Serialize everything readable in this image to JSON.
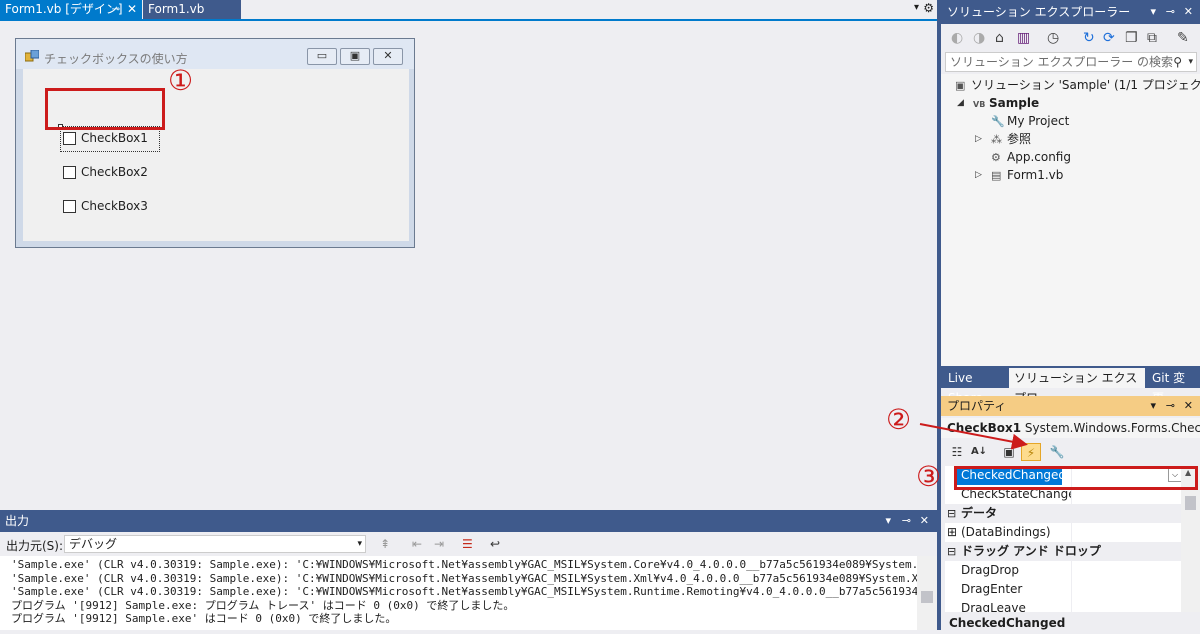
{
  "designer": {
    "tabs": [
      {
        "label": "Form1.vb [デザイン]",
        "pin": "⊸",
        "close": "✕"
      },
      {
        "label": "Form1.vb"
      }
    ],
    "dropdown_glyph": "▾",
    "gear_glyph": "⚙",
    "form": {
      "title": "チェックボックスの使い方",
      "minimize": "▭",
      "maximize": "▣",
      "close": "✕",
      "checkboxes": [
        "CheckBox1",
        "CheckBox2",
        "CheckBox3"
      ]
    },
    "marker1": "①"
  },
  "output": {
    "title": "出力",
    "header_controls": [
      "▾",
      "⊸",
      "✕"
    ],
    "source_label": "出力元(S):",
    "source_value": "デバッグ",
    "dd_glyph": "▾",
    "lines": [
      "'Sample.exe' (CLR v4.0.30319: Sample.exe): 'C:¥WINDOWS¥Microsoft.Net¥assembly¥GAC_MSIL¥System.Core¥v4.0_4.0.0.0__b77a5c561934e089¥System.Core.dll' が読",
      "'Sample.exe' (CLR v4.0.30319: Sample.exe): 'C:¥WINDOWS¥Microsoft.Net¥assembly¥GAC_MSIL¥System.Xml¥v4.0_4.0.0.0__b77a5c561934e089¥System.Xml.dll' が読み",
      "'Sample.exe' (CLR v4.0.30319: Sample.exe): 'C:¥WINDOWS¥Microsoft.Net¥assembly¥GAC_MSIL¥System.Runtime.Remoting¥v4.0_4.0.0.0__b77a5c561934e089¥System.Ru",
      "プログラム '[9912] Sample.exe: プログラム トレース' はコード 0 (0x0) で終了しました。",
      "プログラム '[9912] Sample.exe' はコード 0 (0x0) で終了しました。"
    ]
  },
  "solution_explorer": {
    "title": "ソリューション エクスプローラー",
    "header_controls": [
      "▾",
      "⊸",
      "✕"
    ],
    "search_placeholder": "ソリューション エクスプローラー の検索 (Ctrl+;)",
    "search_icon": "⚲",
    "search_dd": "▾",
    "tree": [
      {
        "label": "ソリューション 'Sample' (1/1 プロジェクト)",
        "icon": "▣",
        "indent": 0,
        "expander": ""
      },
      {
        "label": "Sample",
        "icon": "VB",
        "indent": 1,
        "expander": "◢",
        "bold": true
      },
      {
        "label": "My Project",
        "icon": "🔧",
        "indent": 2,
        "expander": ""
      },
      {
        "label": "参照",
        "icon": "⁂",
        "indent": 2,
        "expander": "▷"
      },
      {
        "label": "App.config",
        "icon": "⚙",
        "indent": 2,
        "expander": ""
      },
      {
        "label": "Form1.vb",
        "icon": "▤",
        "indent": 2,
        "expander": "▷"
      }
    ],
    "tabs": [
      "Live Share",
      "ソリューション エクスプロー...",
      "Git 変更"
    ]
  },
  "properties": {
    "title": "プロパティ",
    "header_controls": [
      "▾",
      "⊸",
      "✕"
    ],
    "object_name": "CheckBox1",
    "object_type": "System.Windows.Forms.CheckBo",
    "object_dd": "▾",
    "toolbar_glyphs": [
      "☷",
      "A↓",
      "▣",
      "⚡",
      "🔧"
    ],
    "rows": [
      {
        "kind": "selected",
        "name": "CheckedChanged"
      },
      {
        "kind": "prop",
        "name": "CheckStateChanged"
      },
      {
        "kind": "cat",
        "name": "データ",
        "toggle": "⊟"
      },
      {
        "kind": "prop",
        "name": "(DataBindings)",
        "toggle": "⊞"
      },
      {
        "kind": "cat",
        "name": "ドラッグ アンド ドロップ",
        "toggle": "⊟"
      },
      {
        "kind": "prop",
        "name": "DragDrop"
      },
      {
        "kind": "prop",
        "name": "DragEnter"
      },
      {
        "kind": "prop",
        "name": "DragLeave"
      }
    ],
    "description": "CheckedChanged",
    "row_dd": "⌵",
    "scroll_up": "▲"
  },
  "markers": {
    "m2": "②",
    "m3": "③"
  },
  "colors": {
    "accent": "#007acc",
    "header": "#3f5a8c",
    "highlight": "#cc1b1b",
    "selection": "#0078d7",
    "active_panel": "#f5cc84"
  }
}
